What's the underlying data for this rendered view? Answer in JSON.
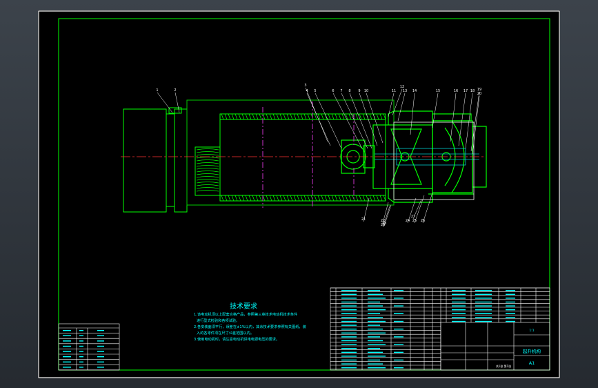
{
  "drawing": {
    "background": "#000000",
    "frame_color": "#ffffff",
    "border_color": "#00ff00",
    "part_color": "#00ff00",
    "centerline_color": "#ff3333",
    "section_color": "#cc33cc",
    "text_color": "#00ffff"
  },
  "leaders": [
    "1",
    "2",
    "3",
    "4",
    "5",
    "6",
    "7",
    "8",
    "9",
    "10",
    "11",
    "12",
    "13",
    "14",
    "15",
    "16",
    "17",
    "18",
    "19",
    "20",
    "21",
    "22",
    "23",
    "24",
    "25",
    "26",
    "27",
    "28"
  ],
  "tech_requirements": {
    "title": "技术要求",
    "lines": [
      "1.该电动机须以上配套合格产品，参照第三章技术电动机技术条件",
      "进行型式检验和各项试验。",
      "2.各安装面须平行，误差在±1%以内，其余技术要求参照有关图纸，装",
      "入的各零件须在尺寸公差范围以内。",
      "3.使用电动机时，请注意电动机供电电源电压的要求。"
    ]
  },
  "title_block": {
    "drawing_name": "起升机构",
    "scale": "1:1",
    "sheet": "A1",
    "sheet_count": "共1张 第1张"
  }
}
